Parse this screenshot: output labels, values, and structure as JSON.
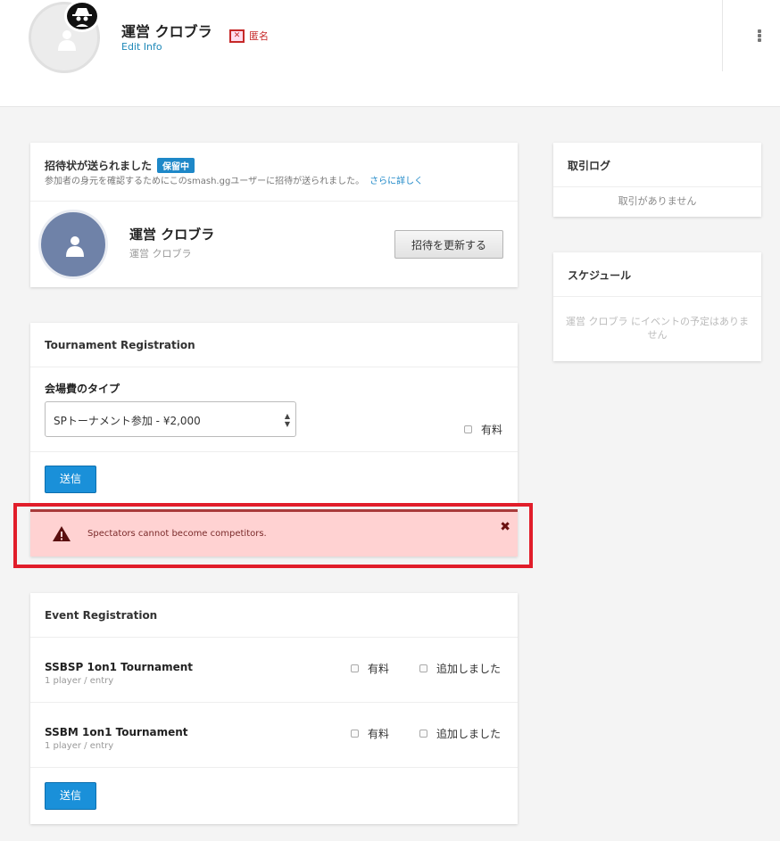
{
  "header": {
    "name": "運営 クロブラ",
    "edit_info": "Edit Info",
    "anon_label": "匿名"
  },
  "invite": {
    "title": "招待状が送られました",
    "status_pill": "保留中",
    "description": "参加者の身元を確認するためにこのsmash.ggユーザーに招待が送られました。",
    "learn_more": "さらに詳しく",
    "player_name": "運営 クロブラ",
    "player_sub": "運営 クロブラ",
    "update_button": "招待を更新する"
  },
  "sidebar": {
    "log_title": "取引ログ",
    "log_empty": "取引がありません",
    "schedule_title": "スケジュール",
    "schedule_empty": "運営 クロブラ にイベントの予定はありません"
  },
  "tournament_registration": {
    "title": "Tournament Registration",
    "fee_type_label": "会場費のタイプ",
    "fee_select_value": "SPトーナメント参加 - ¥2,000",
    "paid_label": "有料",
    "submit_label": "送信"
  },
  "alert": {
    "message": "Spectators cannot become competitors.",
    "close": "✖"
  },
  "event_registration": {
    "title": "Event Registration",
    "events": [
      {
        "name": "SSBSP 1on1 Tournament",
        "meta": "1 player / entry",
        "paid_label": "有料",
        "added_label": "追加しました"
      },
      {
        "name": "SSBM 1on1 Tournament",
        "meta": "1 player / entry",
        "paid_label": "有料",
        "added_label": "追加しました"
      }
    ],
    "submit_label": "送信"
  },
  "colors": {
    "accent": "#1a90d9",
    "alert_bg": "#ffd2d2",
    "alert_border": "#a93a3a",
    "highlight": "#e11d2a"
  }
}
